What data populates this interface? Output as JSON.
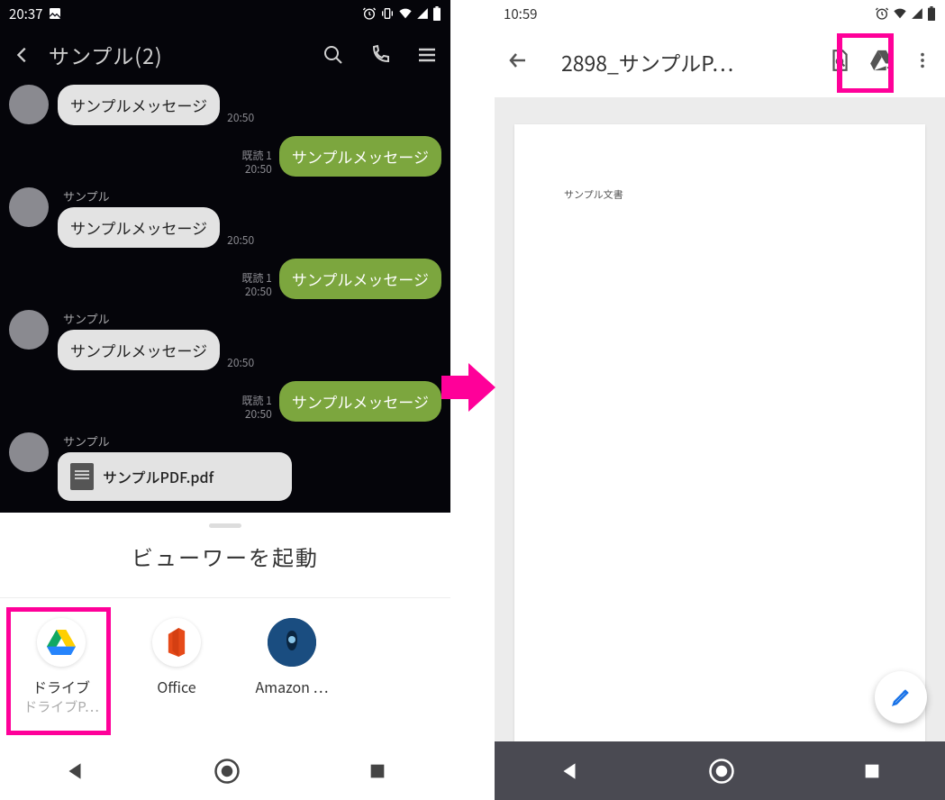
{
  "left": {
    "status_time": "20:37",
    "chat_title": "サンプル(2)",
    "messages": [
      {
        "side": "left",
        "show_avatar": true,
        "show_name": false,
        "text": "サンプルメッセージ",
        "time": "20:50"
      },
      {
        "side": "right",
        "read": "既読 1",
        "time": "20:50",
        "text": "サンプルメッセージ"
      },
      {
        "side": "left",
        "show_avatar": true,
        "show_name": true,
        "name": "サンプル",
        "text": "サンプルメッセージ",
        "time": "20:50"
      },
      {
        "side": "right",
        "read": "既読 1",
        "time": "20:50",
        "text": "サンプルメッセージ"
      },
      {
        "side": "left",
        "show_avatar": true,
        "show_name": true,
        "name": "サンプル",
        "text": "サンプルメッセージ",
        "time": "20:50"
      },
      {
        "side": "right",
        "read": "既読 1",
        "time": "20:50",
        "text": "サンプルメッセージ"
      },
      {
        "side": "left_file",
        "show_avatar": true,
        "show_name": true,
        "name": "サンプル",
        "filename": "サンプルPDF.pdf"
      }
    ],
    "sheet_title": "ビューワーを起動",
    "apps": [
      {
        "label": "ドライブ",
        "sublabel": "ドライブP…"
      },
      {
        "label": "Office",
        "sublabel": ""
      },
      {
        "label": "Amazon …",
        "sublabel": ""
      }
    ]
  },
  "right": {
    "status_time": "10:59",
    "title": "2898_サンプルP…",
    "doc_text": "サンプル文書"
  }
}
